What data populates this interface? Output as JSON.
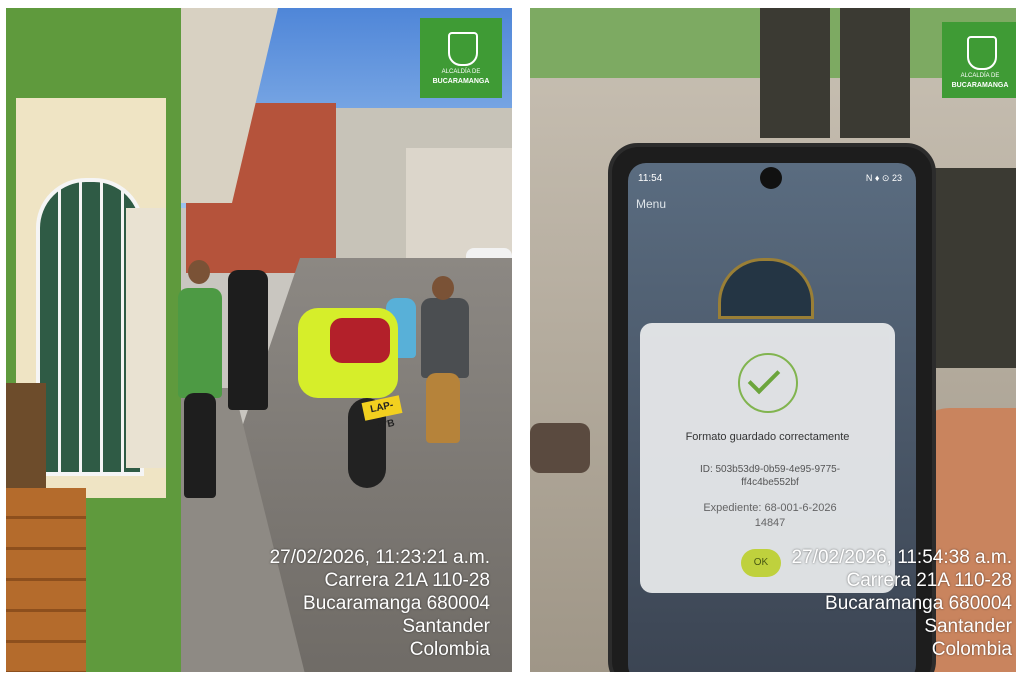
{
  "left_photo": {
    "logo": {
      "small_text": "ALCALDÍA DE",
      "big_text": "BUCARAMANGA"
    },
    "plate": "LAP-57B",
    "stamp": [
      "27/02/2026, 11:23:21 a.m.",
      "Carrera 21A 110-28",
      "Bucaramanga 680004",
      "Santander",
      "Colombia"
    ]
  },
  "right_photo": {
    "logo": {
      "small_text": "ALCALDÍA DE",
      "big_text": "BUCARAMANGA"
    },
    "phone": {
      "status_time": "11:54",
      "status_right": "N ♦ ⊙ 23",
      "menu": "Menu",
      "dialog": {
        "title": "Formato guardado correctamente",
        "id_line1": "ID: 503b53d9-0b59-4e95-9775-",
        "id_line2": "ff4c4be552bf",
        "exp_line1": "Expediente: 68-001-6-2026",
        "exp_line2": "14847",
        "ok": "OK"
      }
    },
    "stamp": [
      "27/02/2026, 11:54:38 a.m.",
      "Carrera 21A 110-28",
      "Bucaramanga 680004",
      "Santander",
      "Colombia"
    ]
  }
}
